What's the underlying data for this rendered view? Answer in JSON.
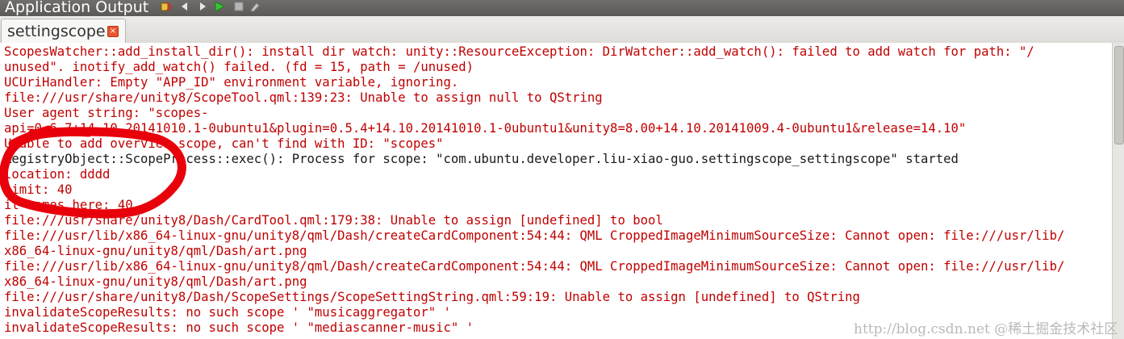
{
  "window": {
    "title": "Application Output"
  },
  "toolbar": {
    "buttons": [
      {
        "icon": "attach-debugger-icon"
      },
      {
        "icon": "previous-item-icon"
      },
      {
        "icon": "next-item-icon"
      },
      {
        "icon": "run-icon"
      },
      {
        "icon": "stop-icon"
      },
      {
        "icon": "clear-output-icon"
      }
    ]
  },
  "tab": {
    "label": "settingscope",
    "close_glyph": "×"
  },
  "colors": {
    "error": "#c00000",
    "normal": "#1a1a1a",
    "scribble": "#e8000b"
  },
  "output": {
    "lines": [
      {
        "text": "ScopesWatcher::add_install_dir(): install dir watch: unity::ResourceException: DirWatcher::add_watch(): failed to add watch for path: \"/",
        "kind": "error"
      },
      {
        "text": "unused\". inotify_add_watch() failed. (fd = 15, path = /unused)",
        "kind": "error"
      },
      {
        "text": "UCUriHandler: Empty \"APP_ID\" environment variable, ignoring.",
        "kind": "error"
      },
      {
        "text": "file:///usr/share/unity8/ScopeTool.qml:139:23: Unable to assign null to QString",
        "kind": "error"
      },
      {
        "text": "User agent string: \"scopes-",
        "kind": "error"
      },
      {
        "text": "api=0.6.7+14.10.20141010.1-0ubuntu1&plugin=0.5.4+14.10.20141010.1-0ubuntu1&unity8=8.00+14.10.20141009.4-0ubuntu1&release=14.10\"",
        "kind": "error"
      },
      {
        "text": "Unable to add overview scope, can't find with ID: \"scopes\"",
        "kind": "error"
      },
      {
        "text": "RegistryObject::ScopeProcess::exec(): Process for scope: \"com.ubuntu.developer.liu-xiao-guo.settingscope_settingscope\" started",
        "kind": "normal"
      },
      {
        "text": "location: dddd",
        "kind": "error"
      },
      {
        "text": "limit: 40",
        "kind": "error"
      },
      {
        "text": "it comes here: 40",
        "kind": "error"
      },
      {
        "text": "file:///usr/share/unity8/Dash/CardTool.qml:179:38: Unable to assign [undefined] to bool",
        "kind": "error"
      },
      {
        "text": "file:///usr/lib/x86_64-linux-gnu/unity8/qml/Dash/createCardComponent:54:44: QML CroppedImageMinimumSourceSize: Cannot open: file:///usr/lib/",
        "kind": "error"
      },
      {
        "text": "x86_64-linux-gnu/unity8/qml/Dash/art.png",
        "kind": "error"
      },
      {
        "text": "file:///usr/lib/x86_64-linux-gnu/unity8/qml/Dash/createCardComponent:54:44: QML CroppedImageMinimumSourceSize: Cannot open: file:///usr/lib/",
        "kind": "error"
      },
      {
        "text": "x86_64-linux-gnu/unity8/qml/Dash/art.png",
        "kind": "error"
      },
      {
        "text": "file:///usr/share/unity8/Dash/ScopeSettings/ScopeSettingString.qml:59:19: Unable to assign [undefined] to QString",
        "kind": "error"
      },
      {
        "text": "invalidateScopeResults: no such scope ' \"musicaggregator\" '",
        "kind": "error"
      },
      {
        "text": "invalidateScopeResults: no such scope ' \"mediascanner-music\" '",
        "kind": "error"
      }
    ]
  },
  "watermark": {
    "text": "http://blog.csdn.net  @稀土掘金技术社区"
  }
}
